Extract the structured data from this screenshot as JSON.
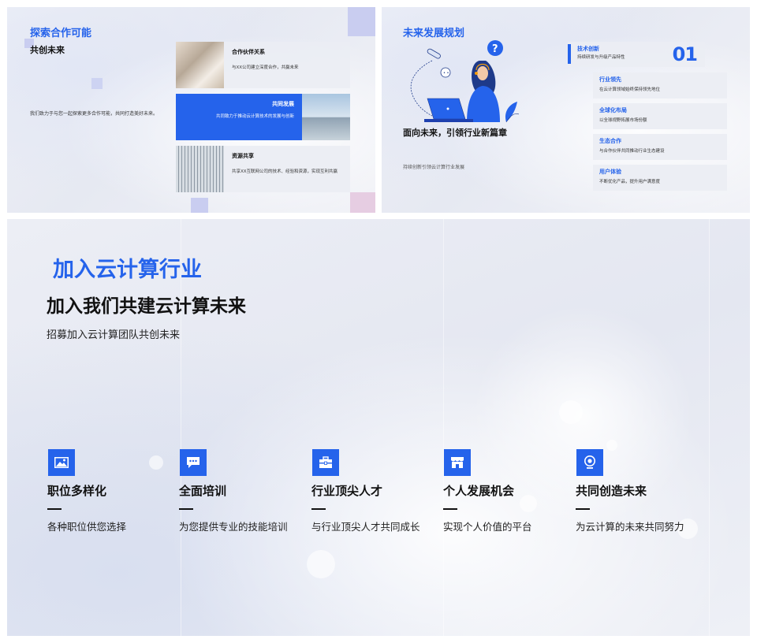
{
  "slide1": {
    "title": "探索合作可能",
    "subtitle": "共创未来",
    "description": "我们致力于与您一起探索更多合作可能，共同打造美好未来。",
    "rows": [
      {
        "heading": "合作伙伴关系",
        "text": "与XX公司建立深度合作，共赢未来"
      },
      {
        "heading": "共同发展",
        "text": "共同致力于推动云计算技术的发展与创新"
      },
      {
        "heading": "资源共享",
        "text": "共享XX互联网公司的技术、经验和资源，实现互利共赢"
      }
    ]
  },
  "slide2": {
    "title": "未来发展规划",
    "headline": "面向未来，引领行业新篇章",
    "caption": "持续创新引领云计算行业发展",
    "highlight": {
      "heading": "技术创新",
      "text": "持续研发与升级产品特性",
      "number": "01"
    },
    "items": [
      {
        "heading": "行业领先",
        "text": "在云计算领域始终保持领先地位"
      },
      {
        "heading": "全球化布局",
        "text": "以全球视野拓展市场份额"
      },
      {
        "heading": "生态合作",
        "text": "与合作伙伴共同推动行业生态建设"
      },
      {
        "heading": "用户体验",
        "text": "不断优化产品，提升用户满意度"
      }
    ]
  },
  "slide3": {
    "kicker": "加入云计算行业",
    "title": "加入我们共建云计算未来",
    "intro": "招募加入云计算团队共创未来",
    "features": [
      {
        "heading": "职位多样化",
        "text": "各种职位供您选择",
        "icon": "image-icon"
      },
      {
        "heading": "全面培训",
        "text": "为您提供专业的技能培训",
        "icon": "chat-icon"
      },
      {
        "heading": "行业顶尖人才",
        "text": "与行业顶尖人才共同成长",
        "icon": "briefcase-icon"
      },
      {
        "heading": "个人发展机会",
        "text": "实现个人价值的平台",
        "icon": "store-icon"
      },
      {
        "heading": "共同创造未来",
        "text": "为云计算的未来共同努力",
        "icon": "location-icon"
      }
    ]
  },
  "colors": {
    "accent": "#2563eb",
    "text": "#111111"
  }
}
